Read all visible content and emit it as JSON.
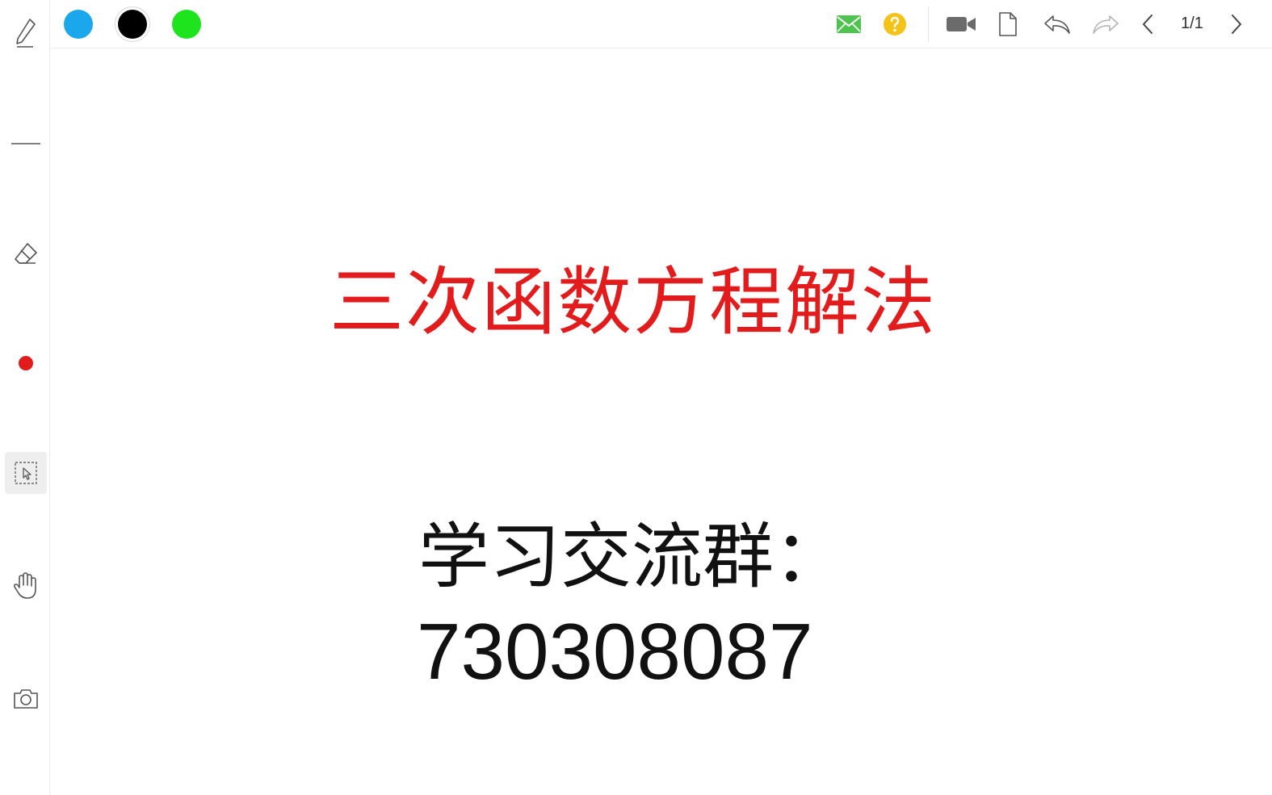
{
  "toolbar": {
    "colors": [
      "#1aa7ec",
      "#000000",
      "#1ee41e"
    ],
    "page_indicator": "1/1",
    "icons": [
      "mail-icon",
      "help-icon",
      "video-icon",
      "document-icon",
      "undo-icon",
      "redo-icon",
      "chevron-left-icon",
      "chevron-right-icon"
    ]
  },
  "sidebar": {
    "tools": [
      "pen-icon",
      "line-icon",
      "eraser-icon",
      "red-dot-color-icon",
      "select-icon",
      "hand-icon",
      "camera-icon"
    ],
    "active_tool": "select-icon",
    "current_color": "#e21c1c"
  },
  "canvas": {
    "title": "三次函数方程解法",
    "group_label": "学习交流群：",
    "group_number": "730308087"
  }
}
